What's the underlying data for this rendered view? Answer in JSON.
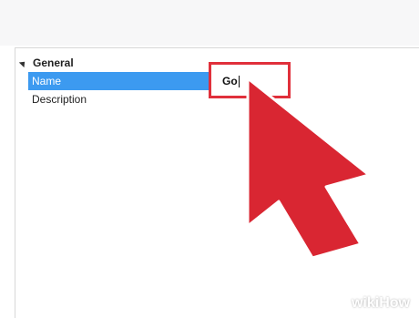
{
  "property_grid": {
    "group": {
      "label": "General"
    },
    "rows": [
      {
        "label": "Name",
        "value": "Go"
      },
      {
        "label": "Description",
        "value": ""
      }
    ]
  },
  "highlight_color": "#e0303b",
  "selection_color": "#3c9af0",
  "cursor": {
    "icon": "cursor-arrow-icon",
    "color": "#d92632"
  },
  "watermark": {
    "text": "wikiHow"
  }
}
